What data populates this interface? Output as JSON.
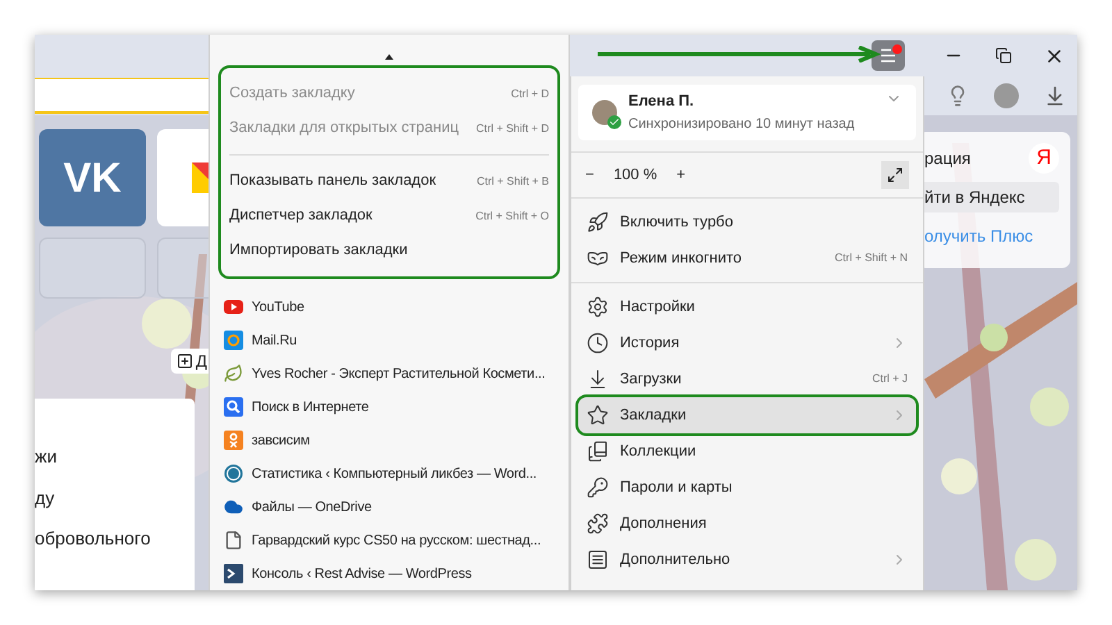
{
  "page": {
    "tiles": [
      {
        "kind": "vk",
        "label": "VK"
      },
      {
        "kind": "mail"
      }
    ],
    "add_button": {
      "label": "Д"
    },
    "card_lines": [
      "жи",
      "ду",
      "обровольного"
    ],
    "yandex_card": {
      "title": "рация",
      "logo": "Я",
      "login_button": "йти в Яндекс",
      "plus_link": "олучить Плюс"
    }
  },
  "bookmarks_menu": {
    "actions": [
      {
        "label": "Создать закладку",
        "shortcut": "Ctrl + D",
        "disabled": true,
        "separator_before": false
      },
      {
        "label": "Закладки для открытых страниц",
        "shortcut": "Ctrl + Shift + D",
        "disabled": true,
        "separator_before": false
      },
      {
        "label": "Показывать панель закладок",
        "shortcut": "Ctrl + Shift + B",
        "disabled": false,
        "separator_before": true
      },
      {
        "label": "Диспетчер закладок",
        "shortcut": "Ctrl + Shift + O",
        "disabled": false,
        "separator_before": false
      },
      {
        "label": "Импортировать закладки",
        "disabled": false,
        "separator_before": false
      }
    ],
    "bookmarks": [
      {
        "kind": "youtube",
        "label": "YouTube"
      },
      {
        "kind": "mail",
        "label": "Mail.Ru"
      },
      {
        "kind": "leaf",
        "label": "Yves Rocher - Эксперт Растительной Космети..."
      },
      {
        "kind": "search",
        "label": "Поиск в Интернете"
      },
      {
        "kind": "ok",
        "label": "завсисим"
      },
      {
        "kind": "wordpress",
        "label": "Статистика ‹ Компьютерный ликбез — Word..."
      },
      {
        "kind": "cloud",
        "label": "Файлы — OneDrive"
      },
      {
        "kind": "file",
        "label": "Гарвардский курс CS50 на русском: шестнад..."
      },
      {
        "kind": "console",
        "label": "Консоль ‹ Rest Advise — WordPress"
      }
    ]
  },
  "main_menu": {
    "profile": {
      "name": "Елена П.",
      "status": "Синхронизировано 10 минут назад",
      "synced": true
    },
    "zoom": {
      "minus": "−",
      "value": "100 %",
      "plus": "+"
    },
    "items": [
      {
        "kind": "turbo",
        "label": "Включить турбо",
        "selected": false,
        "submenu": false,
        "separator_before": false
      },
      {
        "kind": "incognito",
        "label": "Режим инкогнито",
        "shortcut": "Ctrl + Shift + N",
        "selected": false,
        "submenu": false,
        "separator_before": false
      },
      {
        "kind": "settings",
        "label": "Настройки",
        "selected": false,
        "submenu": false,
        "separator_before": true
      },
      {
        "kind": "history",
        "label": "История",
        "submenu": true,
        "selected": false,
        "separator_before": false
      },
      {
        "kind": "downloads",
        "label": "Загрузки",
        "shortcut": "Ctrl + J",
        "selected": false,
        "submenu": false,
        "separator_before": false
      },
      {
        "kind": "bookmarks",
        "label": "Закладки",
        "submenu": true,
        "selected": true,
        "separator_before": false
      },
      {
        "kind": "collections",
        "label": "Коллекции",
        "selected": false,
        "submenu": false,
        "separator_before": false
      },
      {
        "kind": "passwords",
        "label": "Пароли и карты",
        "selected": false,
        "submenu": false,
        "separator_before": false
      },
      {
        "kind": "extensions",
        "label": "Дополнения",
        "selected": false,
        "submenu": false,
        "separator_before": false
      },
      {
        "kind": "more",
        "label": "Дополнительно",
        "submenu": true,
        "selected": false,
        "separator_before": false
      }
    ]
  },
  "toolbar": {
    "menu_notification": true
  }
}
